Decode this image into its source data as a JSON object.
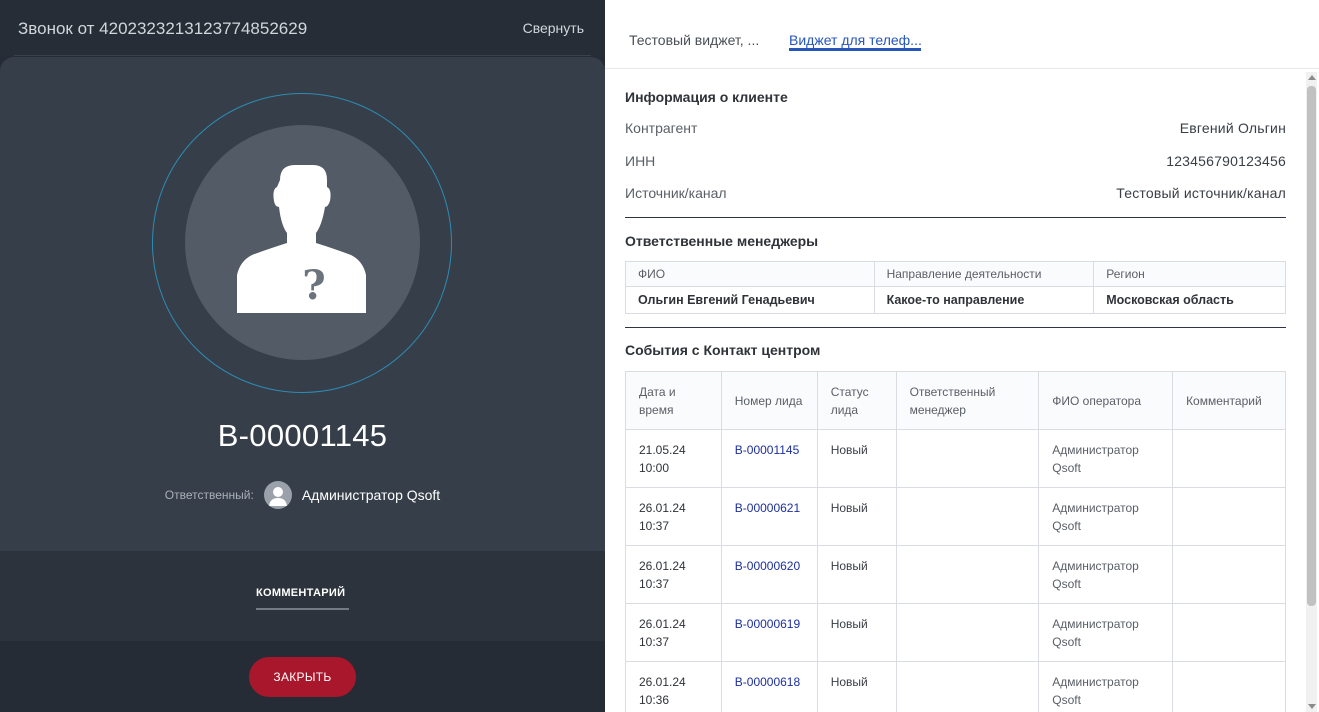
{
  "call": {
    "title": "Звонок от 4202323213123774852629",
    "collapse_label": "Свернуть",
    "lead_number": "В-00001145",
    "responsible_label": "Ответственный:",
    "responsible_name": "Администратор Qsoft",
    "comment_tab": "КОММЕНТАРИЙ",
    "close_label": "ЗАКРЫТЬ",
    "accent_color": "#a8172b",
    "ring_color": "#2d8cb4"
  },
  "widget": {
    "tabs": [
      {
        "label": "Тестовый виджет, ...",
        "active": false
      },
      {
        "label": "Виджет для телеф...",
        "active": true
      }
    ],
    "client_info": {
      "title": "Информация о клиенте",
      "rows": [
        {
          "label": "Контрагент",
          "value": "Евгений Ольгин"
        },
        {
          "label": "ИНН",
          "value": "123456790123456"
        },
        {
          "label": "Источник/канал",
          "value": "Тестовый источник/канал"
        }
      ]
    },
    "managers": {
      "title": "Ответственные менеджеры",
      "columns": [
        "ФИО",
        "Направление деятельности",
        "Регион"
      ],
      "rows": [
        [
          "Ольгин Евгений Генадьевич",
          "Какое-то направление",
          "Московская область"
        ]
      ]
    },
    "events": {
      "title": "События с Контакт центром",
      "columns": [
        "Дата и время",
        "Номер лида",
        "Статус лида",
        "Ответственный менеджер",
        "ФИО оператора",
        "Комментарий"
      ],
      "rows": [
        {
          "date": "21.05.24 10:00",
          "lead": "В-00001145",
          "status": "Новый",
          "manager": "",
          "operator": "Администратор Qsoft",
          "comment": ""
        },
        {
          "date": "26.01.24 10:37",
          "lead": "В-00000621",
          "status": "Новый",
          "manager": "",
          "operator": "Администратор Qsoft",
          "comment": ""
        },
        {
          "date": "26.01.24 10:37",
          "lead": "В-00000620",
          "status": "Новый",
          "manager": "",
          "operator": "Администратор Qsoft",
          "comment": ""
        },
        {
          "date": "26.01.24 10:37",
          "lead": "В-00000619",
          "status": "Новый",
          "manager": "",
          "operator": "Администратор Qsoft",
          "comment": ""
        },
        {
          "date": "26.01.24 10:36",
          "lead": "В-00000618",
          "status": "Новый",
          "manager": "",
          "operator": "Администратор Qsoft",
          "comment": ""
        }
      ]
    }
  }
}
